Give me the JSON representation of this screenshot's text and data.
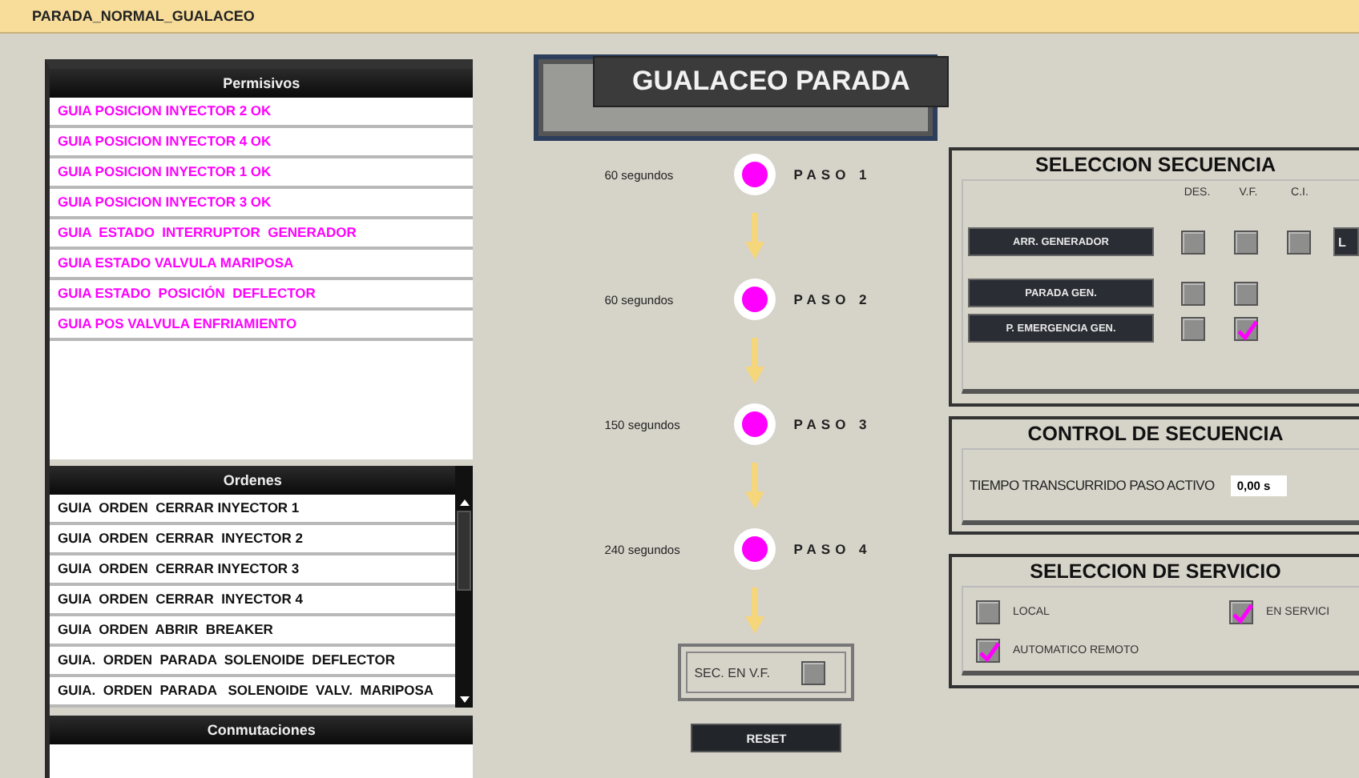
{
  "window": {
    "title": "PARADA_NORMAL_GUALACEO"
  },
  "permisivos": {
    "title": "Permisivos",
    "items": [
      "GUIA POSICION INYECTOR 2 OK",
      "GUIA POSICION INYECTOR 4 OK",
      "GUIA POSICION INYECTOR 1 OK",
      "GUIA POSICION INYECTOR 3 OK",
      "GUIA  ESTADO  INTERRUPTOR  GENERADOR",
      "GUIA ESTADO VALVULA MARIPOSA",
      "GUIA ESTADO  POSICIÓN  DEFLECTOR",
      "GUIA POS VALVULA ENFRIAMIENTO"
    ]
  },
  "ordenes": {
    "title": "Ordenes",
    "items": [
      "GUIA  ORDEN  CERRAR INYECTOR 1",
      "GUIA  ORDEN  CERRAR  INYECTOR 2",
      "GUIA  ORDEN  CERRAR INYECTOR 3",
      "GUIA  ORDEN  CERRAR  INYECTOR 4",
      "GUIA  ORDEN  ABRIR  BREAKER",
      "GUIA.  ORDEN  PARADA  SOLENOIDE  DEFLECTOR",
      "GUIA.  ORDEN  PARADA   SOLENOIDE  VALV.  MARIPOSA"
    ]
  },
  "conmutaciones": {
    "title": "Conmutaciones"
  },
  "sequence": {
    "title": "GUALACEO PARADA",
    "steps": [
      {
        "duration": "60 segundos",
        "label": "PASO 1",
        "color": "#ff00ff"
      },
      {
        "duration": "60 segundos",
        "label": "PASO 2",
        "color": "#ff00ff"
      },
      {
        "duration": "150 segundos",
        "label": "PASO 3",
        "color": "#ff00ff"
      },
      {
        "duration": "240 segundos",
        "label": "PASO 4",
        "color": "#ff00ff"
      }
    ],
    "sec_vf": {
      "label": "SEC. EN V.F.",
      "checked": false
    },
    "reset": "RESET"
  },
  "seleccion_secuencia": {
    "title": "SELECCION SECUENCIA",
    "columns": [
      "DES.",
      "V.F.",
      "C.I."
    ],
    "rows": [
      {
        "label": "ARR. GENERADOR",
        "checks": [
          false,
          false,
          false
        ],
        "extra": "L"
      },
      {
        "label": "PARADA GEN.",
        "checks": [
          false,
          false
        ]
      },
      {
        "label": "P. EMERGENCIA GEN.",
        "checks": [
          false,
          true
        ]
      }
    ]
  },
  "control_secuencia": {
    "title": "CONTROL DE SECUENCIA",
    "label": "TIEMPO TRANSCURRIDO PASO ACTIVO",
    "value": "0,00 s"
  },
  "seleccion_servicio": {
    "title": "SELECCION DE SERVICIO",
    "options": [
      {
        "label": "LOCAL",
        "checked": false
      },
      {
        "label": "EN SERVICI",
        "checked": true
      },
      {
        "label": "AUTOMATICO REMOTO",
        "checked": true
      }
    ]
  }
}
